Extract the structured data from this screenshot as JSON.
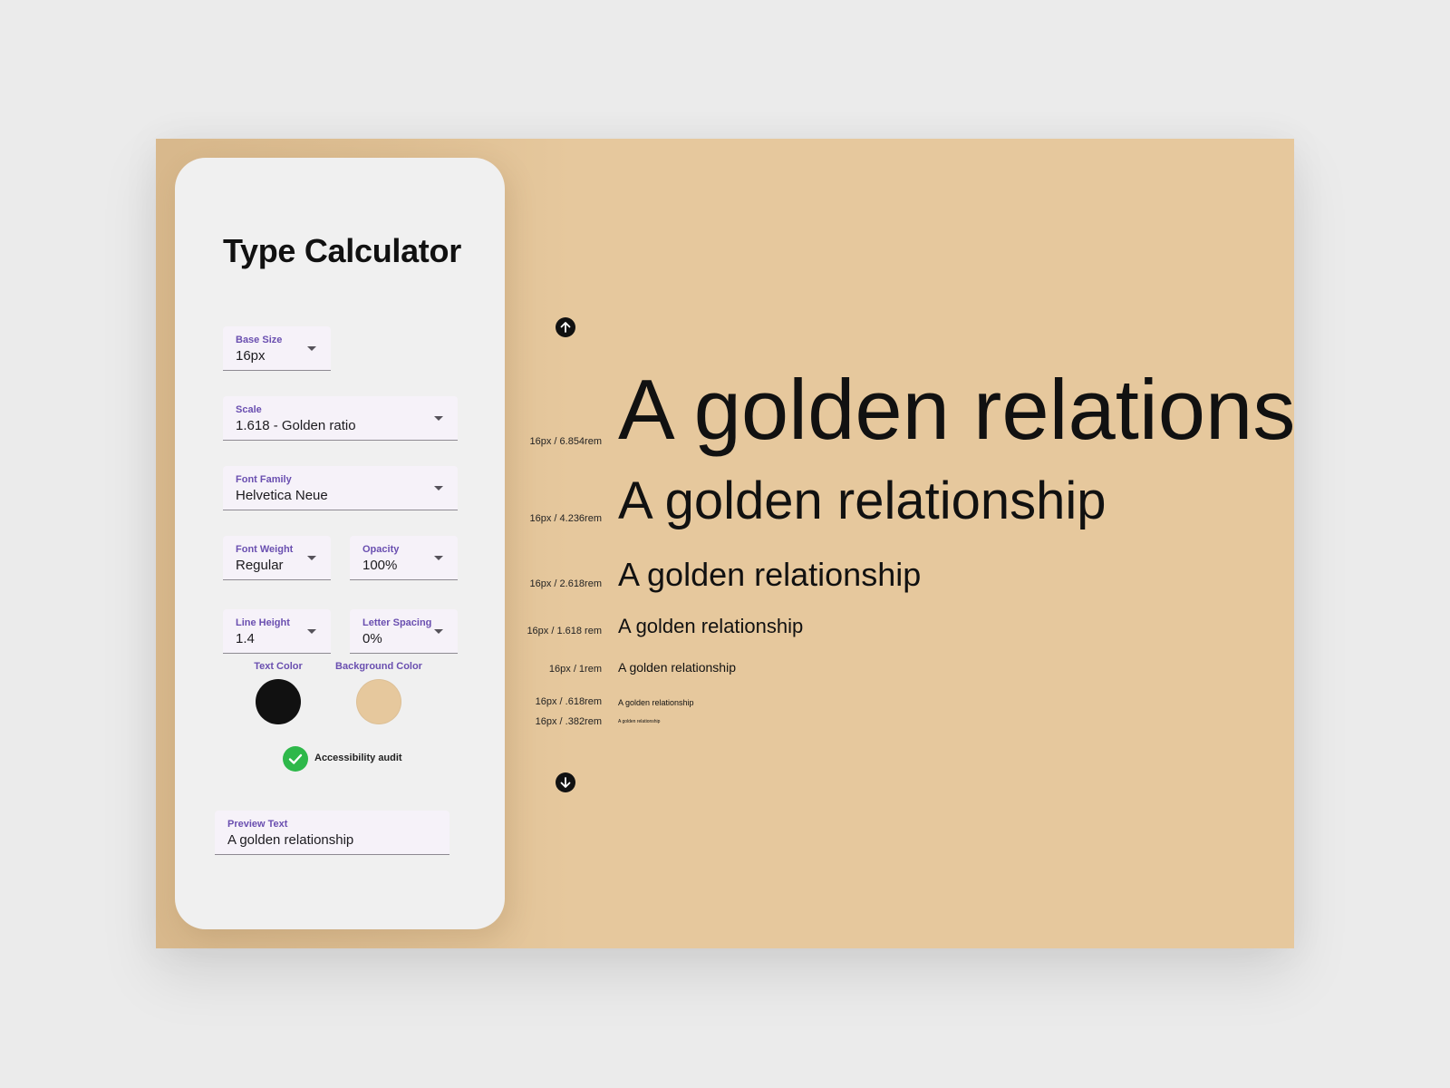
{
  "app": {
    "title": "Type Calculator"
  },
  "controls": {
    "base_size": {
      "label": "Base Size",
      "value": "16px"
    },
    "scale": {
      "label": "Scale",
      "value": "1.618 - Golden ratio"
    },
    "font_family": {
      "label": "Font Family",
      "value": "Helvetica Neue"
    },
    "font_weight": {
      "label": "Font Weight",
      "value": "Regular"
    },
    "opacity": {
      "label": "Opacity",
      "value": "100%"
    },
    "line_height": {
      "label": "Line Height",
      "value": "1.4"
    },
    "letter_spacing": {
      "label": "Letter Spacing",
      "value": "0%"
    }
  },
  "colors": {
    "text_color": {
      "label": "Text Color",
      "hex": "#111111"
    },
    "background_color": {
      "label": "Background Color",
      "hex": "#e6c89d"
    }
  },
  "audit": {
    "label": "Accessibility audit",
    "status": "pass",
    "icon": "check-circle-icon",
    "color": "#2eb84a"
  },
  "preview": {
    "label": "Preview Text",
    "value": "A golden relationship"
  },
  "navigation": {
    "up_icon": "arrow-up-icon",
    "down_icon": "arrow-down-icon"
  },
  "samples": [
    {
      "label": "16px / 6.854rem",
      "text": "A golden relationship"
    },
    {
      "label": "16px / 4.236rem",
      "text": "A golden relationship"
    },
    {
      "label": "16px / 2.618rem",
      "text": "A golden relationship"
    },
    {
      "label": "16px / 1.618 rem",
      "text": "A golden relationship"
    },
    {
      "label": "16px / 1rem",
      "text": "A golden relationship"
    },
    {
      "label": "16px / .618rem",
      "text": "A golden relationship"
    },
    {
      "label": "16px / .382rem",
      "text": "A golden relationship"
    }
  ]
}
